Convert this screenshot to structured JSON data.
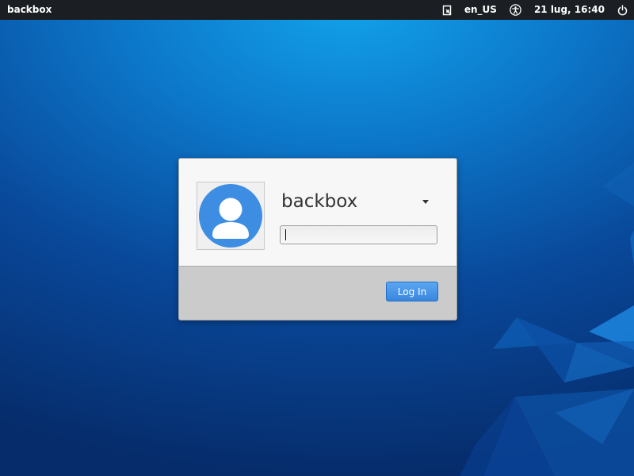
{
  "panel": {
    "hostname": "backbox",
    "keyboard_layout": "en_US",
    "clock": "21 lug, 16:40",
    "icons": {
      "session": "session-icon",
      "accessibility": "accessibility-icon",
      "power": "power-icon"
    }
  },
  "greeter": {
    "username": "backbox",
    "password_value": "",
    "login_label": "Log In",
    "avatar_icon": "user-avatar-icon"
  },
  "colors": {
    "panel_bg": "#1b1f23",
    "accent": "#3a86de",
    "avatar_bg": "#3d8ee3"
  }
}
